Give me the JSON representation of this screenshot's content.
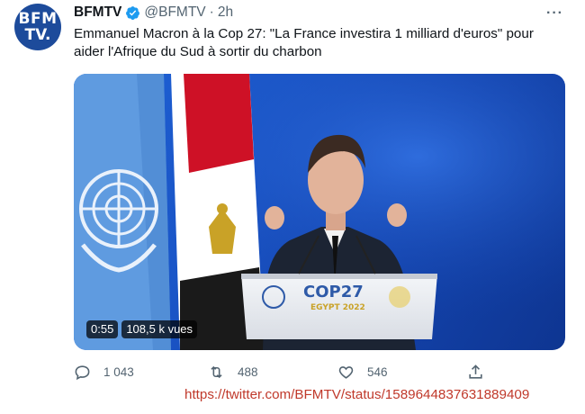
{
  "account": {
    "avatar_line1": "BFM",
    "avatar_line2": "TV.",
    "name": "BFMTV",
    "handle": "@BFMTV",
    "separator": "·",
    "time": "2h"
  },
  "more_label": "···",
  "tweet_text": "Emmanuel Macron à la Cop 27: \"La France investira 1 milliard d'euros\" pour aider l'Afrique du Sud à sortir du charbon",
  "video": {
    "duration": "0:55",
    "views": "108,5 k vues",
    "podium": {
      "logo_main": "COP27",
      "logo_sub": "EGYPT 2022"
    }
  },
  "actions": {
    "replies": "1 043",
    "retweets": "488",
    "likes": "546"
  },
  "source_url": "https://twitter.com/BFMTV/status/1589644837631889409",
  "colors": {
    "verified": "#1d9bf0",
    "avatar_bg": "#1d4b9b",
    "url_text": "#c0392b",
    "stage_blue": "#1a55c7"
  }
}
